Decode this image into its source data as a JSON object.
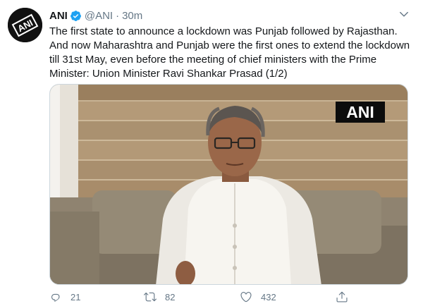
{
  "tweet": {
    "author_name": "ANI",
    "handle": "@ANI",
    "separator": "·",
    "time": "30m",
    "text": "The first state to announce a lockdown was Punjab followed by Rajasthan. And now Maharashtra and Punjab were the first ones to extend the lockdown till 31st May, even before the meeting of chief ministers with the Prime Minister: Union Minister Ravi Shankar Prasad (1/2)",
    "avatar_logo_text": "ANI",
    "media_watermark": "ANI",
    "verified": true
  },
  "actions": {
    "reply_count": "21",
    "retweet_count": "82",
    "like_count": "432"
  },
  "icons": {
    "reply": "reply-icon",
    "retweet": "retweet-icon",
    "like": "like-icon",
    "share": "share-icon",
    "caret": "chevron-down-icon",
    "verified": "verified-badge-icon"
  },
  "colors": {
    "text": "#14171a",
    "secondary": "#657786",
    "verified": "#1da1f2"
  }
}
